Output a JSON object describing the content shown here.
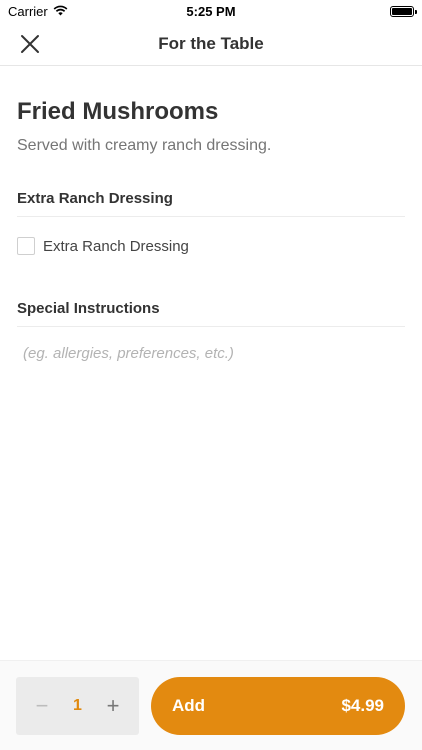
{
  "status_bar": {
    "carrier": "Carrier",
    "time": "5:25 PM"
  },
  "nav": {
    "title": "For the Table",
    "close_icon": "close-icon"
  },
  "item": {
    "name": "Fried Mushrooms",
    "description": "Served with creamy ranch dressing."
  },
  "modifiers": {
    "header": "Extra Ranch Dressing",
    "options": [
      {
        "label": "Extra Ranch Dressing",
        "checked": false
      }
    ]
  },
  "instructions": {
    "header": "Special Instructions",
    "placeholder": "(eg. allergies, preferences, etc.)",
    "value": ""
  },
  "footer": {
    "decrement": "−",
    "quantity": "1",
    "increment": "+",
    "add_label": "Add",
    "price": "$4.99"
  },
  "colors": {
    "accent": "#e38a10",
    "quantity": "#e0890e"
  }
}
